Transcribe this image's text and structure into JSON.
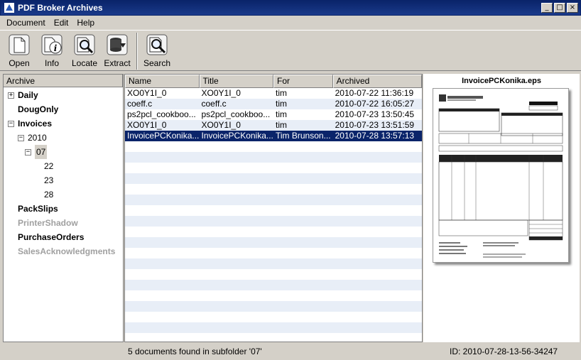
{
  "window": {
    "title": "PDF Broker Archives",
    "controls": [
      "_",
      "□",
      "×"
    ]
  },
  "menu": [
    "Document",
    "Edit",
    "Help"
  ],
  "toolbar": {
    "open": "Open",
    "info": "Info",
    "locate": "Locate",
    "extract": "Extract",
    "search": "Search"
  },
  "tree": {
    "header": "Archive",
    "nodes": {
      "daily": "Daily",
      "dougonly": "DougOnly",
      "invoices": "Invoices",
      "y2010": "2010",
      "m07": "07",
      "d22": "22",
      "d23": "23",
      "d28": "28",
      "packslips": "PackSlips",
      "printershadow": "PrinterShadow",
      "purchaseorders": "PurchaseOrders",
      "salesack": "SalesAcknowledgments"
    }
  },
  "list": {
    "columns": {
      "name": "Name",
      "title": "Title",
      "for": "For",
      "archived": "Archived"
    },
    "rows": [
      {
        "name": "XO0Y1I_0",
        "title": "XO0Y1I_0",
        "for": "tim",
        "archived": "2010-07-22 11:36:19"
      },
      {
        "name": "coeff.c",
        "title": "coeff.c",
        "for": "tim",
        "archived": "2010-07-22 16:05:27"
      },
      {
        "name": "ps2pcl_cookboo...",
        "title": "ps2pcl_cookboo...",
        "for": "tim",
        "archived": "2010-07-23 13:50:45"
      },
      {
        "name": "XO0Y1I_0",
        "title": "XO0Y1I_0",
        "for": "tim",
        "archived": "2010-07-23 13:51:59"
      },
      {
        "name": "InvoicePCKonika...",
        "title": "InvoicePCKonika...",
        "for": "Tim Brunson...",
        "archived": "2010-07-28 13:57:13"
      }
    ]
  },
  "preview": {
    "title": "InvoicePCKonika.eps"
  },
  "status": {
    "message": "5 documents found in subfolder '07'",
    "id": "ID: 2010-07-28-13-56-34247"
  }
}
